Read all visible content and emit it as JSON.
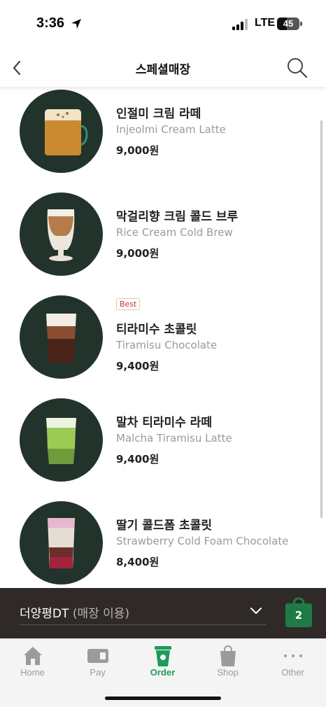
{
  "status": {
    "time": "3:36",
    "network": "LTE",
    "battery": "45",
    "battery_level": 0.45
  },
  "header": {
    "title": "스페셜매장",
    "back_icon": "chevron-left-icon",
    "search_icon": "search-icon"
  },
  "menu": {
    "items": [
      {
        "name_ko": "인절미 크림 라떼",
        "name_en": "Injeolmi Cream Latte",
        "price": "9,000원",
        "badge": ""
      },
      {
        "name_ko": "막걸리향 크림 콜드 브루",
        "name_en": "Rice Cream Cold Brew",
        "price": "9,000원",
        "badge": ""
      },
      {
        "name_ko": "티라미수 초콜릿",
        "name_en": "Tiramisu Chocolate",
        "price": "9,400원",
        "badge": "Best"
      },
      {
        "name_ko": "말차 티라미수 라떼",
        "name_en": "Malcha Tiramisu Latte",
        "price": "9,400원",
        "badge": ""
      },
      {
        "name_ko": "딸기 콜드폼 초콜릿",
        "name_en": "Strawberry Cold Foam Chocolate",
        "price": "8,400원",
        "badge": ""
      }
    ]
  },
  "store": {
    "name": "더양평DT",
    "mode": "(매장 이용)",
    "cart_count": "2"
  },
  "tabs": [
    {
      "label": "Home",
      "icon": "home-icon",
      "active": false
    },
    {
      "label": "Pay",
      "icon": "card-icon",
      "active": false
    },
    {
      "label": "Order",
      "icon": "cup-icon",
      "active": true
    },
    {
      "label": "Shop",
      "icon": "bag-icon",
      "active": false
    },
    {
      "label": "Other",
      "icon": "more-icon",
      "active": false
    }
  ],
  "colors": {
    "brand_green": "#1e9c5a",
    "thumb_bg": "#22332c",
    "store_bar_bg": "#2f2a28",
    "cart_green": "#1f7a47",
    "badge_red": "#c0392b"
  }
}
